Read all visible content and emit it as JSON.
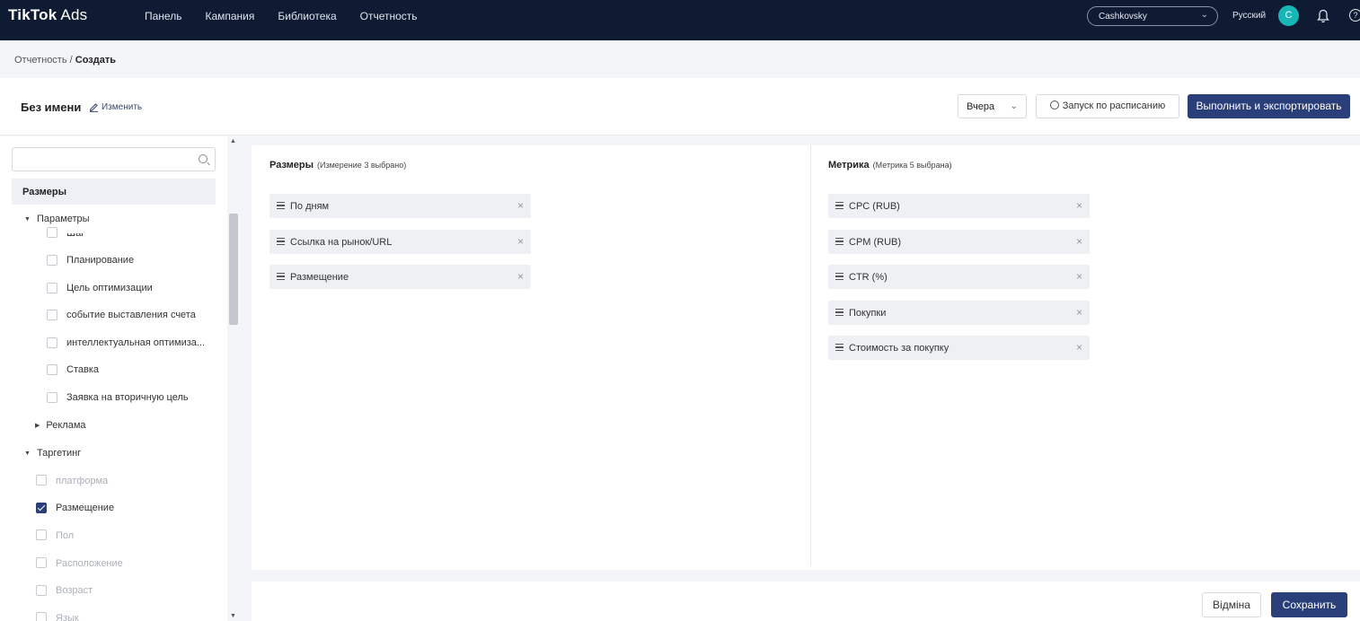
{
  "app": {
    "logo_main": "TikTok",
    "logo_suffix": " Ads"
  },
  "nav": {
    "items": [
      "Панель",
      "Кампания",
      "Библиотека",
      "Отчетность"
    ]
  },
  "account": {
    "name": "Cashkovsky"
  },
  "language": "Русский",
  "avatar_letter": "C",
  "breadcrumb": {
    "parent": "Отчетность",
    "separator": " / ",
    "current": "Создать"
  },
  "report": {
    "title": "Без имени",
    "edit_label": "Изменить"
  },
  "toolbar": {
    "date_range": "Вчера",
    "schedule_label": "Запуск по расписанию",
    "run_label": "Выполнить и экспортировать"
  },
  "sidebar": {
    "section_title": "Размеры",
    "group_params": "Параметры",
    "params_items": [
      {
        "label": "Шаг",
        "checked": false
      },
      {
        "label": "Планирование",
        "checked": false
      },
      {
        "label": "Цель оптимизации",
        "checked": false
      },
      {
        "label": "событие выставления счета",
        "checked": false
      },
      {
        "label": "интеллектуальная оптимиза...",
        "checked": false
      },
      {
        "label": "Ставка",
        "checked": false
      },
      {
        "label": "Заявка на вторичную цель",
        "checked": false
      }
    ],
    "group_ads": "Реклама",
    "group_targeting": "Таргетинг",
    "targeting_items": [
      {
        "label": "платформа",
        "checked": false
      },
      {
        "label": "Размещение",
        "checked": true
      },
      {
        "label": "Пол",
        "checked": false
      },
      {
        "label": "Расположение",
        "checked": false
      },
      {
        "label": "Возраст",
        "checked": false
      },
      {
        "label": "Язык",
        "checked": false
      }
    ]
  },
  "dimensions": {
    "title": "Размеры",
    "subtitle": "(Измерение 3 выбрано)",
    "chips": [
      "По дням",
      "Ссылка на рынок/URL",
      "Размещение"
    ]
  },
  "metrics": {
    "title": "Метрика",
    "subtitle": "(Метрика 5 выбрана)",
    "chips": [
      "CPC (RUB)",
      "CPM (RUB)",
      "CTR (%)",
      "Покупки",
      "Стоимость за покупку"
    ]
  },
  "footer": {
    "cancel_label": "Відміна",
    "save_label": "Сохранить"
  },
  "colors": {
    "nav_bg": "#0f1b33",
    "primary": "#2a3f7a",
    "avatar": "#18b7b7"
  }
}
